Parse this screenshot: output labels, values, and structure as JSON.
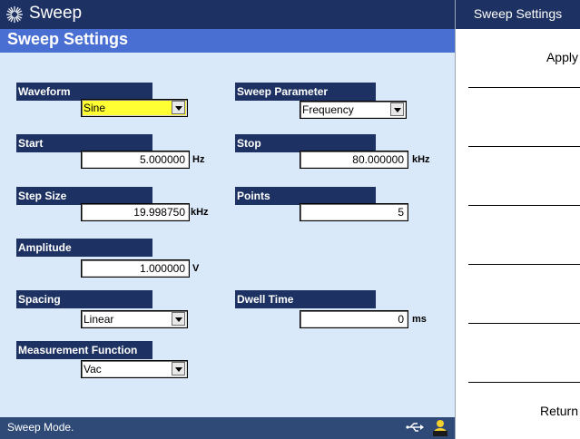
{
  "app": {
    "title": "Sweep"
  },
  "header": {
    "title": "Sweep Settings"
  },
  "fields": {
    "waveform": {
      "label": "Waveform",
      "value": "Sine"
    },
    "sweep_parameter": {
      "label": "Sweep Parameter",
      "value": "Frequency"
    },
    "start": {
      "label": "Start",
      "value": "5.000000",
      "unit": "Hz"
    },
    "stop": {
      "label": "Stop",
      "value": "80.000000",
      "unit": "kHz"
    },
    "step_size": {
      "label": "Step Size",
      "value": "19.998750",
      "unit": "kHz"
    },
    "points": {
      "label": "Points",
      "value": "5"
    },
    "amplitude": {
      "label": "Amplitude",
      "value": "1.000000",
      "unit": "V"
    },
    "spacing": {
      "label": "Spacing",
      "value": "Linear"
    },
    "dwell_time": {
      "label": "Dwell Time",
      "value": "0",
      "unit": "ms"
    },
    "measurement_function": {
      "label": "Measurement Function",
      "value": "Vac"
    }
  },
  "status": {
    "message": "Sweep Mode.",
    "icons": [
      "usb-icon",
      "user-icon"
    ]
  },
  "softkeys": {
    "title": "Sweep Settings",
    "keys": [
      "Apply",
      "",
      "",
      "",
      "",
      "",
      "Return"
    ]
  },
  "colors": {
    "navy": "#1d3262",
    "header_blue": "#4a6fd2",
    "panel": "#dae9fa",
    "highlight": "#ffff33"
  }
}
